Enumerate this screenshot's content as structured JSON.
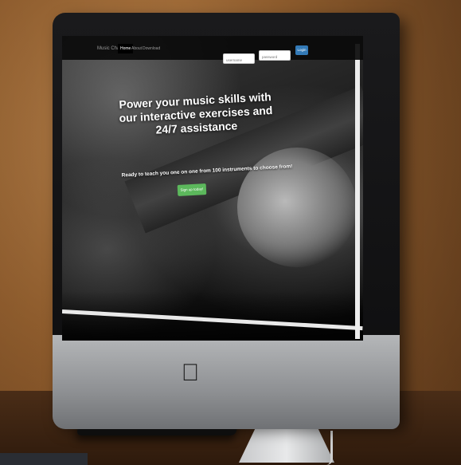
{
  "navbar": {
    "brand": "Music Chart",
    "items": [
      {
        "label": "Home",
        "active": true
      },
      {
        "label": "About",
        "active": false
      },
      {
        "label": "Download",
        "active": false
      }
    ],
    "username_placeholder": "username",
    "password_placeholder": "password",
    "login_label": "Login"
  },
  "hero": {
    "title": "Power your music skills with our interactive exercises and 24/7 assistance",
    "subtitle": "Ready to teach you one on one from 100 instruments to choose from!",
    "cta_label": "Sign up today!"
  },
  "colors": {
    "login_button": "#337ab7",
    "cta_button": "#5cb85c",
    "navbar_bg": "#0a0a0a"
  },
  "icons": {
    "hardware_logo": "apple-icon"
  }
}
